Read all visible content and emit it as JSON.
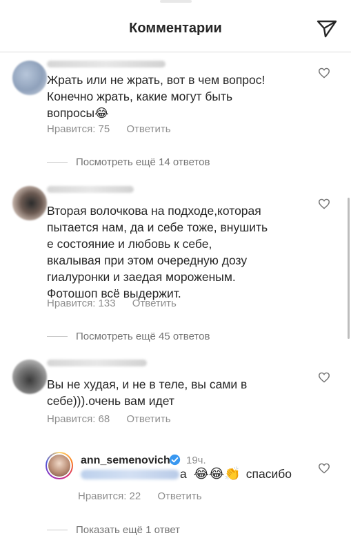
{
  "header": {
    "title": "Комментарии",
    "send_icon": "paper-plane-icon"
  },
  "comments": [
    {
      "text": "Жрать или не жрать, вот в чем вопрос!\nКонечно жрать, какие могут быть\nвопросы😂",
      "likes": "Нравится: 75",
      "reply": "Ответить",
      "view_replies": "Посмотреть ещё 14 ответов"
    },
    {
      "text": "Вторая волочкова на подходе,которая\nпытается нам, да и себе тоже, внушить\n    е состояние и любовь к себе,\nвкалывая при этом очередную дозу\nгиалуронки и заедая мороженым.\nФотошоп всё выдержит.",
      "likes": "Нравится: 133",
      "reply": "Ответить",
      "view_replies": "Посмотреть ещё 45 ответов"
    },
    {
      "text": "Вы не худая, и не в теле, вы сами в\nсебе))).очень вам идет",
      "likes": "Нравится: 68",
      "reply": "Ответить"
    }
  ],
  "reply": {
    "username": "ann_semenovich",
    "time": "19ч.",
    "text_prefix": "а",
    "emojis": "😂😂👏",
    "text_suffix": "спасибо",
    "likes": "Нравится: 22",
    "reply": "Ответить",
    "show_more": "Показать ещё 1 ответ"
  },
  "colors": {
    "text": "#262626",
    "secondary": "#8e8e8e",
    "divider": "#dbdbdb"
  }
}
